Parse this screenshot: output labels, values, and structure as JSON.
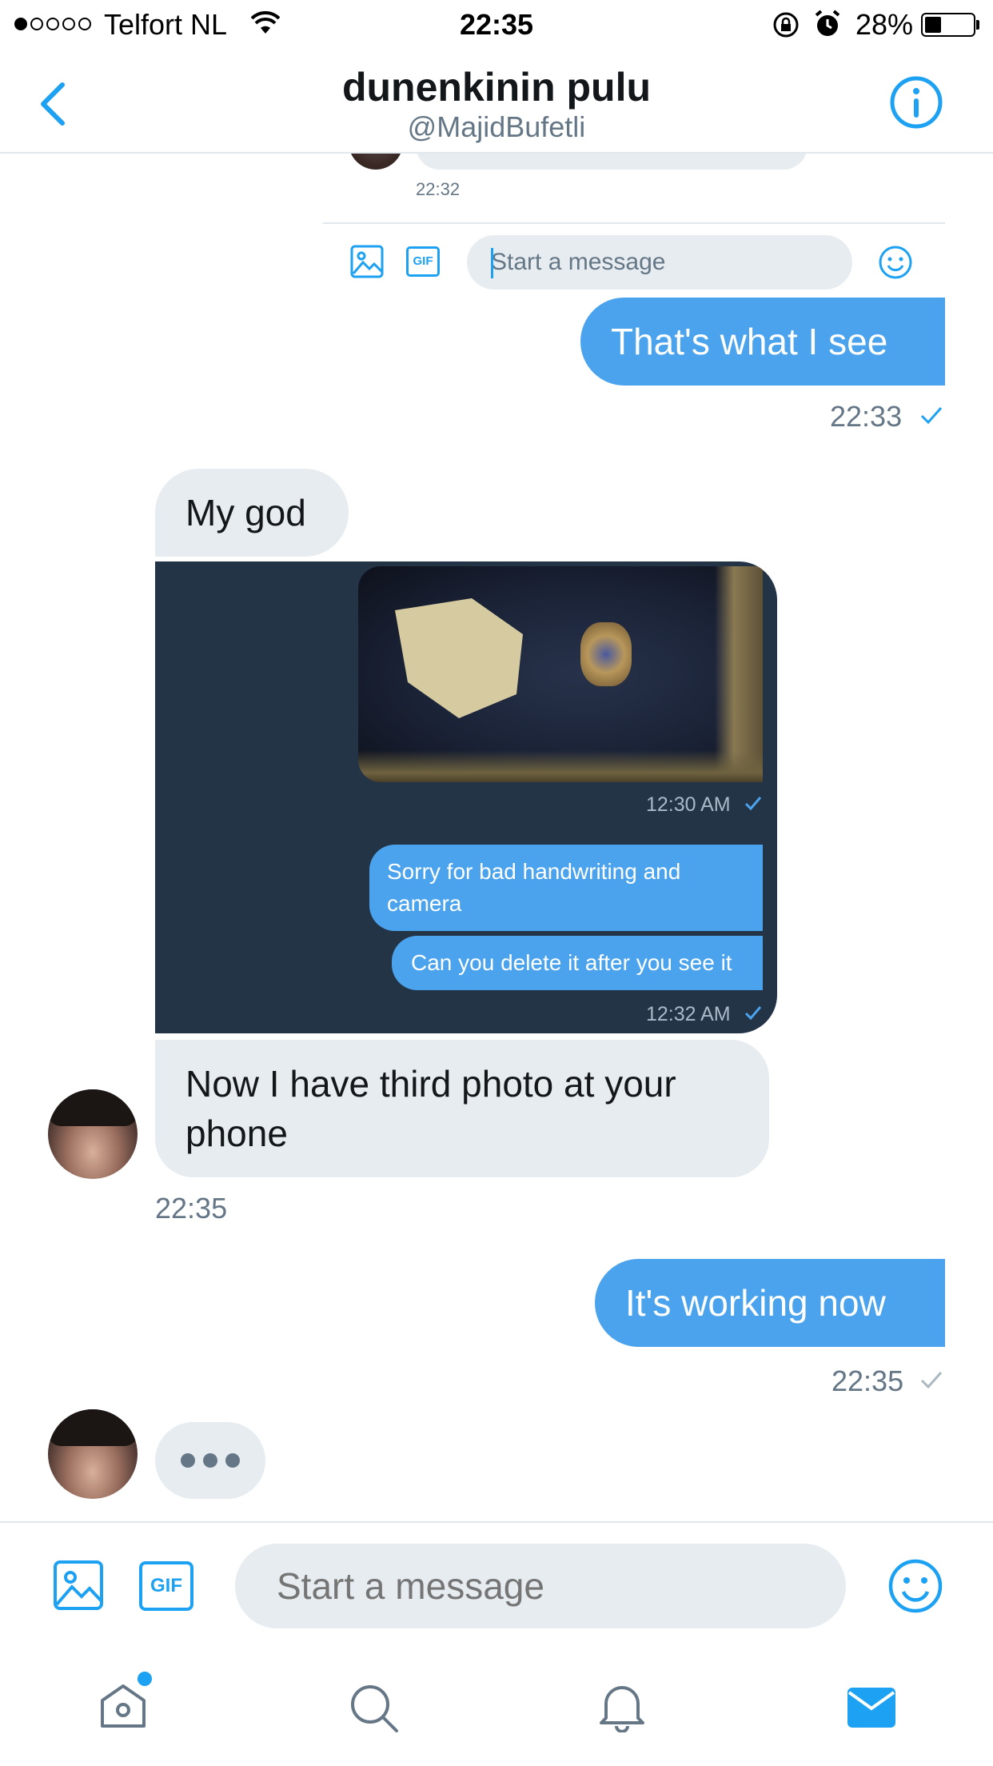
{
  "status_bar": {
    "carrier": "Telfort NL",
    "time": "22:35",
    "battery": "28%"
  },
  "header": {
    "title": "dunenkinin pulu",
    "handle": "@MajidBufetli"
  },
  "embedded": {
    "time": "22:32",
    "gif_label": "GIF",
    "placeholder": "Start a message",
    "photo_time": "12:30 AM",
    "msg1": "Sorry for bad handwriting and camera",
    "msg2": "Can you delete it after you see it",
    "msg_time": "12:32 AM"
  },
  "messages": {
    "m1": "That's what I see",
    "m1_time": "22:33",
    "m2": "My god",
    "m3": "Now I have third photo at your phone",
    "m3_time": "22:35",
    "m4": "It's working now",
    "m4_time": "22:35"
  },
  "composer": {
    "gif_label": "GIF",
    "placeholder": "Start a message"
  },
  "colors": {
    "accent": "#1da1f2",
    "outgoing_bubble": "#4aa3ec",
    "incoming_bubble": "#e6ecf0",
    "secondary_text": "#657786"
  },
  "icons": [
    "back-icon",
    "info-icon",
    "photo-icon",
    "gif-icon",
    "emoji-icon",
    "home-icon",
    "search-icon",
    "bell-icon",
    "mail-icon"
  ]
}
